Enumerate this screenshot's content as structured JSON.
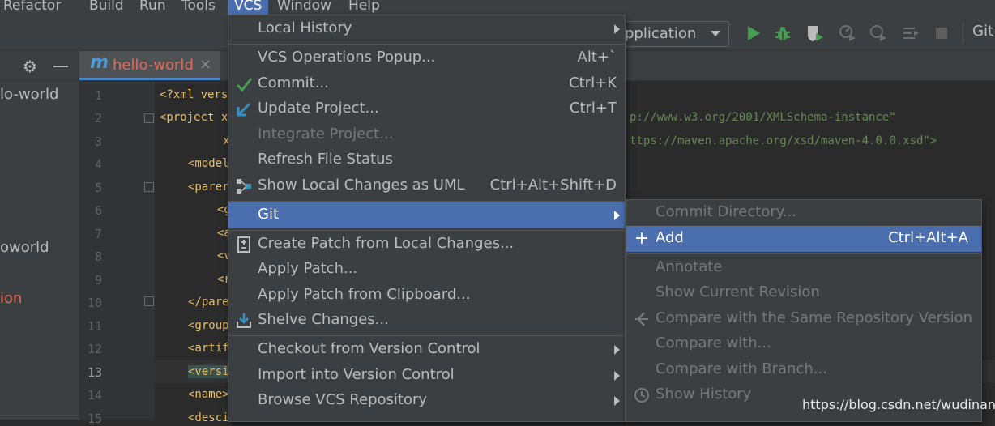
{
  "menubar": {
    "items": [
      "Refactor",
      "Build",
      "Run",
      "Tools",
      "VCS",
      "Window",
      "Help"
    ],
    "active": "VCS"
  },
  "toolbar": {
    "run_config": "pplication",
    "git_label": "Git:"
  },
  "tab": {
    "icon_letter": "m",
    "title": "hello-world",
    "close": "×"
  },
  "project_panel": {
    "items": [
      "lo-world",
      "oworld",
      "ion"
    ]
  },
  "editor": {
    "line_numbers": [
      "1",
      "2",
      "3",
      "4",
      "5",
      "6",
      "7",
      "8",
      "9",
      "10",
      "11",
      "12",
      "13",
      "14",
      "15"
    ],
    "current_line": "13",
    "lines": [
      "<?xml vers",
      "<project x",
      "x",
      "<model",
      "<parer",
      "<g",
      "<a",
      "<v",
      "<r",
      "</pare",
      "<group",
      "<artif",
      "<versi",
      "<name>",
      "<desci"
    ],
    "url_line_2": "p://www.w3.org/2001/XMLSchema-instance\"",
    "url_line_3": "ttps://maven.apache.org/xsd/maven-4.0.0.xsd\">"
  },
  "vcs_menu": {
    "items": [
      {
        "label": "Local History",
        "submenu": true
      },
      {
        "label": "VCS Operations Popup...",
        "shortcut": "Alt+`"
      },
      {
        "label": "Commit...",
        "shortcut": "Ctrl+K",
        "icon": "check-icon"
      },
      {
        "label": "Update Project...",
        "shortcut": "Ctrl+T",
        "icon": "update-arrow-icon"
      },
      {
        "label": "Integrate Project...",
        "disabled": true
      },
      {
        "label": "Refresh File Status"
      },
      {
        "label": "Show Local Changes as UML",
        "shortcut": "Ctrl+Alt+Shift+D",
        "icon": "uml-diagram-icon"
      },
      {
        "label": "Git",
        "submenu": true,
        "highlighted": true
      },
      {
        "label": "Create Patch from Local Changes...",
        "icon": "patch-icon"
      },
      {
        "label": "Apply Patch..."
      },
      {
        "label": "Apply Patch from Clipboard..."
      },
      {
        "label": "Shelve Changes...",
        "icon": "shelve-icon"
      },
      {
        "label": "Checkout from Version Control",
        "submenu": true
      },
      {
        "label": "Import into Version Control",
        "submenu": true
      },
      {
        "label": "Browse VCS Repository",
        "submenu": true
      }
    ]
  },
  "git_menu": {
    "items": [
      {
        "label": "Commit Directory...",
        "disabled": true
      },
      {
        "label": "Add",
        "shortcut": "Ctrl+Alt+A",
        "highlighted": true,
        "icon": "plus-icon"
      },
      {
        "label": "Annotate",
        "disabled": true
      },
      {
        "label": "Show Current Revision",
        "disabled": true
      },
      {
        "label": "Compare with the Same Repository Version",
        "disabled": true,
        "icon": "compare-icon"
      },
      {
        "label": "Compare with...",
        "disabled": true
      },
      {
        "label": "Compare with Branch...",
        "disabled": true
      },
      {
        "label": "Show History",
        "disabled": true,
        "icon": "clock-icon"
      }
    ]
  },
  "watermark": "https://blog.csdn.net/wudinaniya",
  "colors": {
    "highlight": "#4b6eaf",
    "menu_bg": "#3c3f41",
    "editor_bg": "#2b2b2b",
    "tab_title": "#e06c5a",
    "check_green": "#499c54",
    "update_blue": "#3592c4"
  }
}
